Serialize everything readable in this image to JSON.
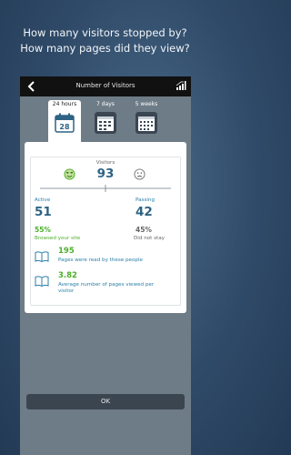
{
  "headline": {
    "line1": "How many visitors stopped by?",
    "line2": "How many pages did they view?"
  },
  "topbar": {
    "title": "Number of Visitors"
  },
  "periods": [
    {
      "label": "24 hours",
      "calendar_day": "28",
      "active": true
    },
    {
      "label": "7 days",
      "active": false
    },
    {
      "label": "5 weeks",
      "active": false
    }
  ],
  "visitors": {
    "label": "Visitors",
    "total": "93"
  },
  "active": {
    "label": "Active",
    "value": "51",
    "percent": "55%",
    "caption": "Browsed your site"
  },
  "passing": {
    "label": "Passing",
    "value": "42",
    "percent": "45%",
    "caption": "Did not stay"
  },
  "pages": {
    "value": "195",
    "caption": "Pages were read by these people"
  },
  "average": {
    "value": "3.82",
    "caption_line1": "Average number of pages viewed per",
    "caption_line2": "visitor"
  },
  "ok_label": "OK",
  "colors": {
    "accent_green": "#4caf2a",
    "accent_teal": "#2c7fa8",
    "dark_number": "#2e6384"
  }
}
